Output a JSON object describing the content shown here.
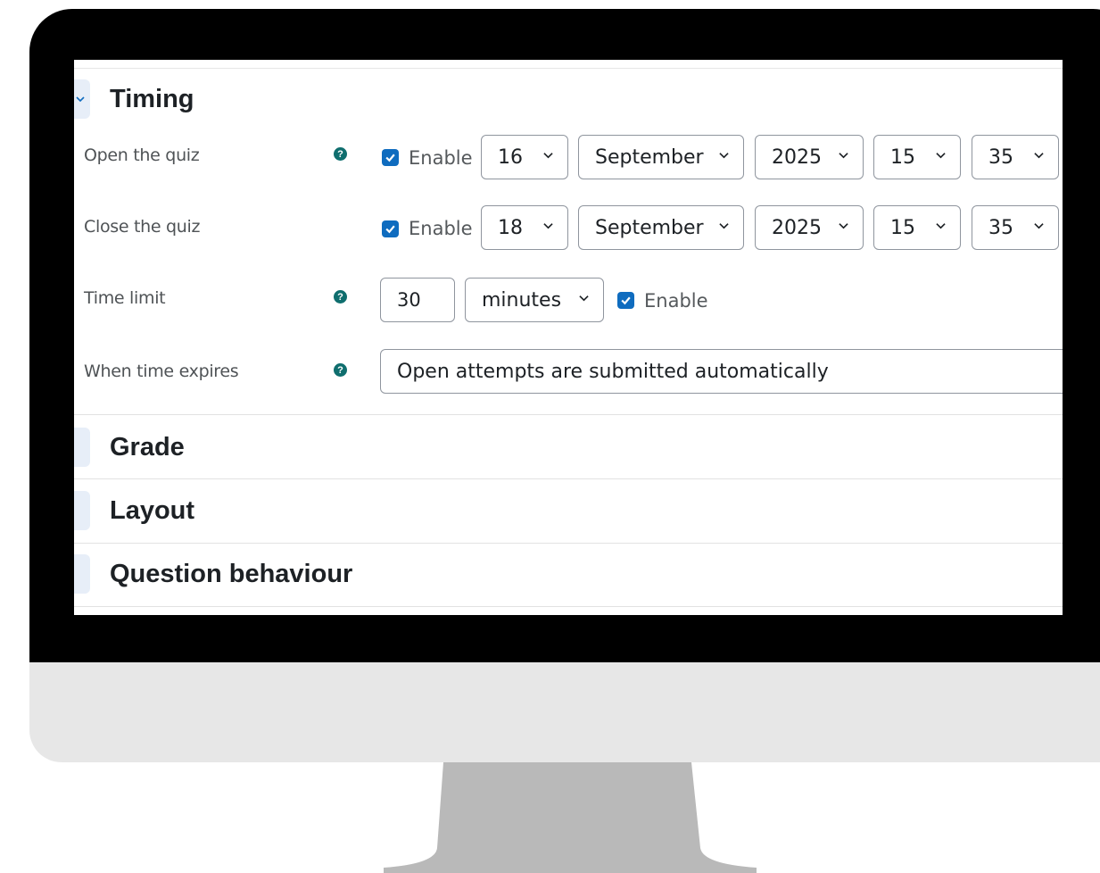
{
  "sections": {
    "timing": "Timing",
    "grade": "Grade",
    "layout": "Layout",
    "question_behaviour": "Question behaviour"
  },
  "open_quiz": {
    "label": "Open the quiz",
    "enable_label": "Enable",
    "enabled": true,
    "day": "16",
    "month": "September",
    "year": "2025",
    "hour": "15",
    "minute": "35"
  },
  "close_quiz": {
    "label": "Close the quiz",
    "enable_label": "Enable",
    "enabled": true,
    "day": "18",
    "month": "September",
    "year": "2025",
    "hour": "15",
    "minute": "35"
  },
  "time_limit": {
    "label": "Time limit",
    "value": "30",
    "unit": "minutes",
    "enable_label": "Enable",
    "enabled": true
  },
  "when_time_expires": {
    "label": "When time expires",
    "value": "Open attempts are submitted automatically"
  },
  "icons": {
    "help": "question-circle-icon",
    "dropdown": "chevron-down-icon",
    "checkbox": "check-icon"
  },
  "colors": {
    "accent": "#0f6cbf",
    "help": "#0f6e6e",
    "bezel": "#000000",
    "chin": "#e7e7e7",
    "stand": "#b9b9b9"
  }
}
